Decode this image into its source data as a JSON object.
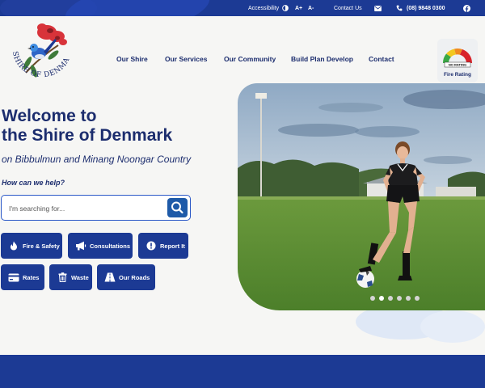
{
  "topbar": {
    "accessibility": "Accessibility",
    "font_up": "A+",
    "font_down": "A-",
    "contact": "Contact Us",
    "phone": "(08) 9848 0300"
  },
  "logo": {
    "text": "SHIRE OF DENMARK"
  },
  "nav": [
    "Our Shire",
    "Our Services",
    "Our Community",
    "Build Plan Develop",
    "Contact"
  ],
  "fire_rating": {
    "gauge_label": "NO RATING",
    "label": "Fire Rating"
  },
  "hero": {
    "title_line1": "Welcome to",
    "title_line2": "the Shire of Denmark",
    "subtitle": "on Bibbulmun and Minang Noongar Country",
    "help": "How can we help?",
    "search_placeholder": "I'm searching for..."
  },
  "quick_links": [
    "Fire & Safety",
    "Consultations",
    "Report It",
    "Rates",
    "Waste",
    "Our Roads"
  ],
  "carousel": {
    "slides": 6,
    "active": 2
  },
  "colors": {
    "brand": "#1c3a94",
    "text": "#1c2d6e",
    "accent": "#1e5aa8"
  }
}
